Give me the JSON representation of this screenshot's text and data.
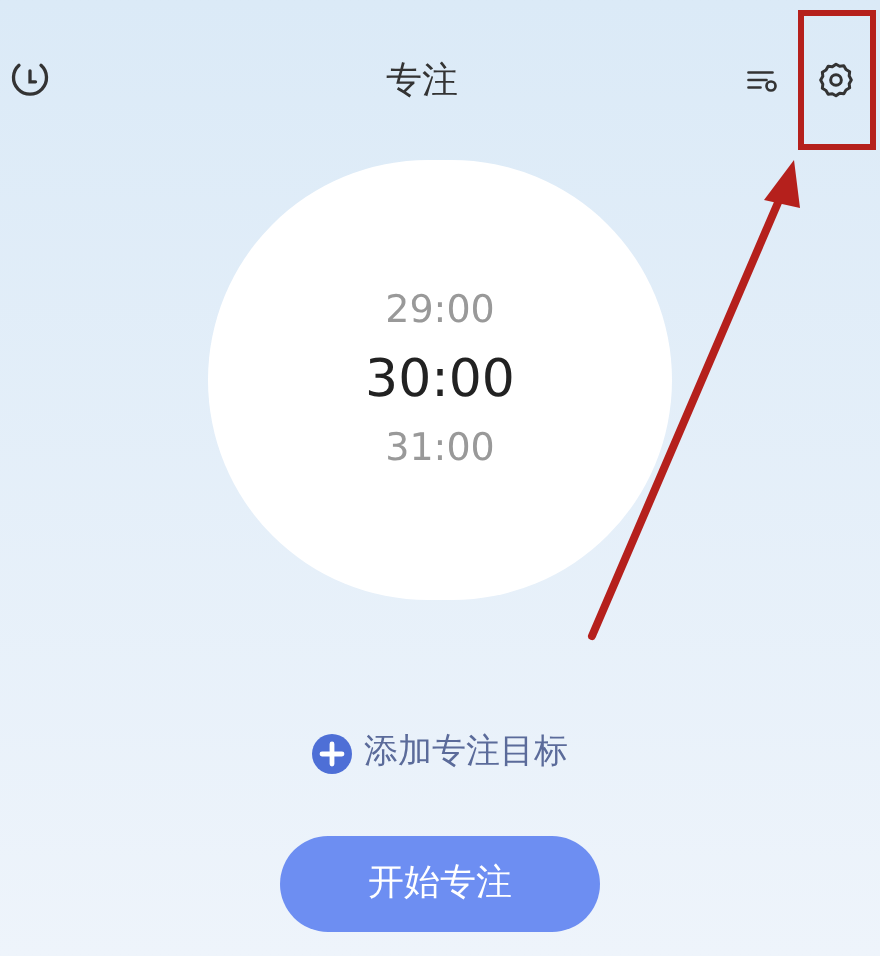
{
  "header": {
    "title": "专注"
  },
  "picker": {
    "items": [
      {
        "label": "29:00",
        "selected": false
      },
      {
        "label": "30:00",
        "selected": true
      },
      {
        "label": "31:00",
        "selected": false
      }
    ]
  },
  "add_goal": {
    "label": "添加专注目标"
  },
  "start_button": {
    "label": "开始专注"
  }
}
